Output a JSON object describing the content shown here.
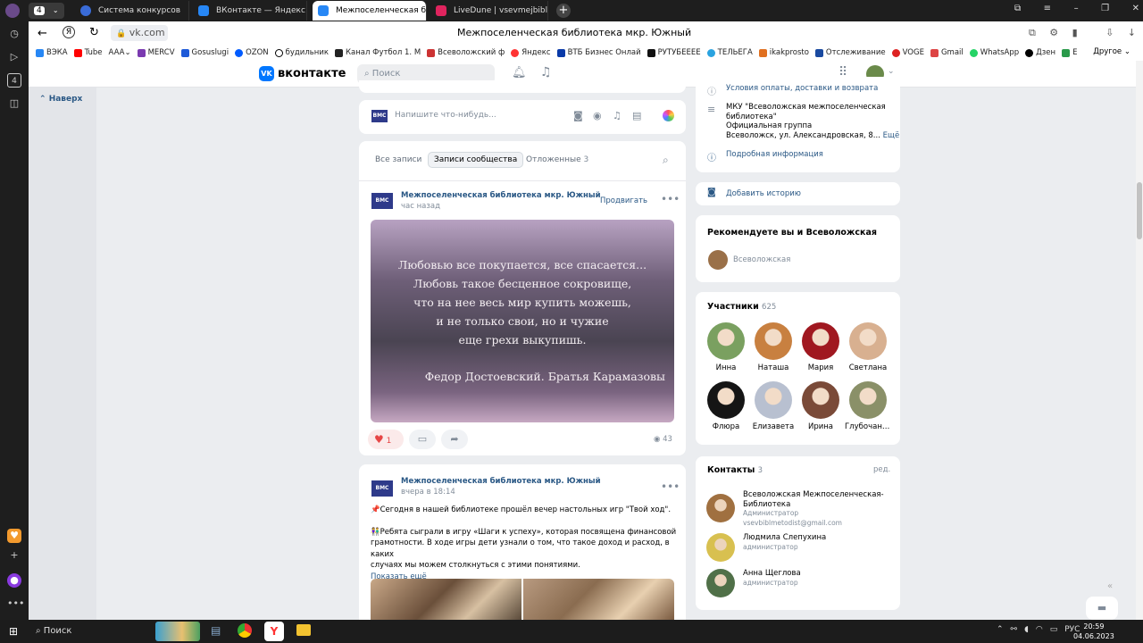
{
  "tabs": [
    {
      "label": "",
      "color": "#444"
    },
    {
      "label": "Система конкурсов",
      "color": "#3a6cd8"
    },
    {
      "label": "ВКонтакте — Яндекс Дис",
      "color": "#2787f5"
    },
    {
      "label": "Межпоселенческая биб",
      "color": "#2787f5"
    },
    {
      "label": "LiveDune | vsevmejbibl_club",
      "color": "#e0245e"
    }
  ],
  "tab_counter": "4",
  "window_title": "Межпоселенческая библиотека мкр. Южный",
  "url": "vk.com",
  "bookmarks": [
    "ВЭКА",
    "Tube",
    "AAA",
    "MERCV",
    "Gosuslugi",
    "OZON",
    "будильник",
    "Канал Футбол 1. М",
    "Всеволожский ф",
    "Яндекс",
    "ВТБ Бизнес Онлай",
    "РУТУБЕЕЕЕ",
    "ТЕЛЬЕГА",
    "ikakprosto",
    "Отслеживание",
    "VOGE",
    "Gmail",
    "WhatsApp",
    "Дзен",
    "Е"
  ],
  "bookmarks_other": "Другое",
  "vk": {
    "logo": "вконтакте",
    "search_placeholder": "Поиск",
    "back_top": "Наверх"
  },
  "composer": {
    "placeholder": "Напишите что-нибудь..."
  },
  "filters": {
    "all": "Все записи",
    "community": "Записи сообщества",
    "postponed": "Отложенные",
    "postponed_count": "3"
  },
  "post1": {
    "author": "Межпоселенческая библиотека мкр. Южный",
    "time": "час назад",
    "promote": "Продвигать",
    "quote": [
      "Любовью все покупается, все спасается...",
      "Любовь такое бесценное сокровище,",
      "что на нее весь мир купить можешь,",
      "и не только свои, но и чужие",
      "еще грехи выкупишь."
    ],
    "sign": "Федор Достоевский. Братья Карамазовы",
    "likes": "1",
    "views": "43"
  },
  "post2": {
    "author": "Межпоселенческая библиотека мкр. Южный",
    "time": "вчера в 18:14",
    "line1": "📌Сегодня в нашей библиотеке прошёл вечер настольных игр \"Твой ход\".",
    "line2": "👫Ребята сыграли в игру «Шаги к успеху», которая посвящена финансовой",
    "line3": "грамотности. В ходе игры дети узнали о том, что такое доход и расход, в каких",
    "line4": "случаях мы можем столкнуться с этими понятиями.",
    "more": "Показать ещё"
  },
  "info": {
    "delivery": "Условия оплаты, доставки и возврата",
    "desc1": "МКУ \"Всеволожская межпоселенческая",
    "desc2": "библиотека\"",
    "desc3": "Официальная группа",
    "desc4": "Всеволожск, ул. Александровская, 8...",
    "more": "Ещё",
    "detail": "Подробная информация"
  },
  "story": "Добавить историю",
  "recommend": {
    "title": "Рекомендуете вы и Всеволожская",
    "name": "Всеволожская"
  },
  "members": {
    "title": "Участники",
    "count": "625",
    "people": [
      {
        "name": "Инна",
        "color": "#7aa060"
      },
      {
        "name": "Наташа",
        "color": "#c88040"
      },
      {
        "name": "Мария",
        "color": "#a01820"
      },
      {
        "name": "Светлана",
        "color": "#d8b090"
      },
      {
        "name": "Флюра",
        "color": "#151515"
      },
      {
        "name": "Елизавета",
        "color": "#b8c0d0"
      },
      {
        "name": "Ирина",
        "color": "#7a4a38"
      },
      {
        "name": "Глубочанск...",
        "color": "#8a9068"
      }
    ]
  },
  "contacts": {
    "title": "Контакты",
    "count": "3",
    "edit": "ред.",
    "list": [
      {
        "name1": "Всеволожская Межпоселенческая-",
        "name2": "Библиотека",
        "role": "Администратор",
        "email": "vsevbiblmetodist@gmail.com",
        "color": "#a07040"
      },
      {
        "name1": "Людмила Слепухина",
        "name2": "",
        "role": "администратор",
        "email": "",
        "color": "#d8c050"
      },
      {
        "name1": "Анна Щеглова",
        "name2": "",
        "role": "администратор",
        "email": "",
        "color": "#507048"
      }
    ]
  },
  "taskbar": {
    "search": "Поиск",
    "lang": "РУС",
    "time": "20:59",
    "date": "04.06.2023"
  }
}
